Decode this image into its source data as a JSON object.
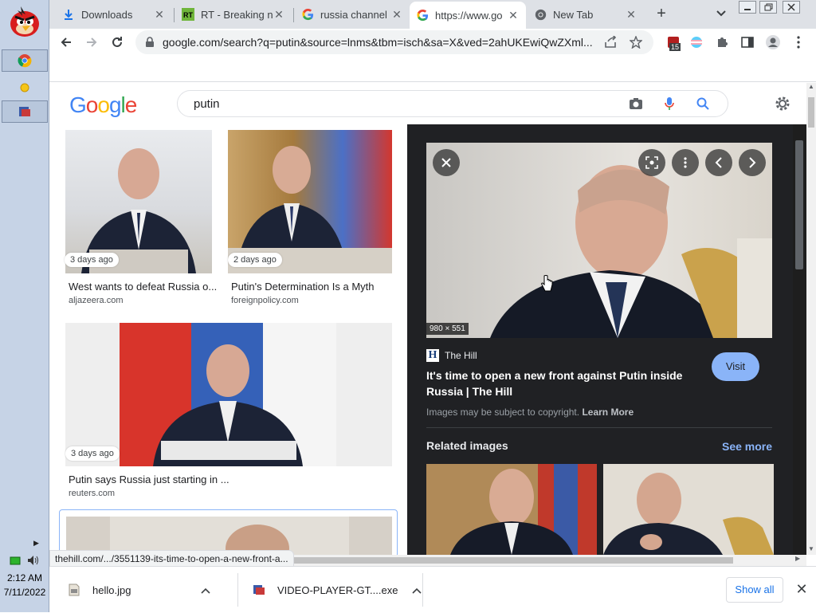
{
  "taskbar": {
    "time": "2:12 AM",
    "date": "7/11/2022",
    "items": [
      "chrome-icon",
      "sun-icon",
      "app-icon"
    ]
  },
  "tabs": [
    {
      "label": "Downloads",
      "icon": "download-icon"
    },
    {
      "label": "RT - Breaking n",
      "icon": "rt-icon"
    },
    {
      "label": "russia channel",
      "icon": "google-icon"
    },
    {
      "label": "https://www.go",
      "icon": "google-icon"
    },
    {
      "label": "New Tab",
      "icon": "chrome-icon"
    }
  ],
  "toolbar": {
    "url": "google.com/search?q=putin&source=lnms&tbm=isch&sa=X&ved=2ahUKEwiQwZXml...",
    "ext_badge": "15"
  },
  "google": {
    "logo": "Google",
    "query": "putin"
  },
  "results": [
    {
      "ago": "3 days ago",
      "title": "West wants to defeat Russia o...",
      "source": "aljazeera.com"
    },
    {
      "ago": "2 days ago",
      "title": "Putin's Determination Is a Myth",
      "source": "foreignpolicy.com"
    },
    {
      "ago": "3 days ago",
      "title": "Putin says Russia just starting in ...",
      "source": "reuters.com"
    }
  ],
  "viewer": {
    "dimensions": "980 × 551",
    "source_name": "The Hill",
    "source_logo": "H",
    "title": "It's time to open a new front against Putin inside Russia | The Hill",
    "visit": "Visit",
    "copyright": "Images may be subject to copyright.",
    "learn_more": "Learn More",
    "related_heading": "Related images",
    "see_more": "See more"
  },
  "status_url": "thehill.com/.../3551139-its-time-to-open-a-new-front-a...",
  "downloads": {
    "items": [
      {
        "name": "hello.jpg"
      },
      {
        "name": "VIDEO-PLAYER-GT....exe"
      }
    ],
    "show_all": "Show all"
  },
  "colors": {
    "accent": "#1a73e8",
    "viewer_bg": "#202124",
    "visit_btn": "#8ab4f8",
    "taskbar": "#c6d3e6"
  }
}
